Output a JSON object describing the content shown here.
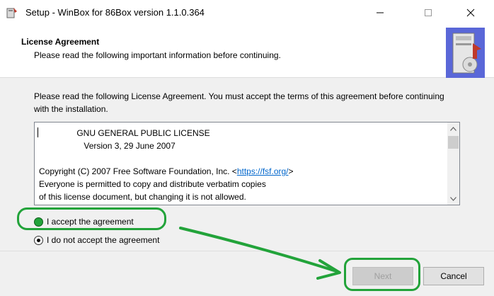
{
  "window": {
    "title": "Setup - WinBox for 86Box version 1.1.0.364",
    "controls": [
      "minimize",
      "maximize",
      "close"
    ]
  },
  "header": {
    "title": "License Agreement",
    "subtitle": "Please read the following important information before continuing."
  },
  "main": {
    "intro": "Please read the following License Agreement. You must accept the terms of this agreement before continuing with the installation.",
    "license_lines": [
      "                GNU GENERAL PUBLIC LICENSE",
      "                   Version 3, 29 June 2007",
      "",
      "Copyright (C) 2007 Free Software Foundation, Inc. <",
      "Everyone is permitted to copy and distribute verbatim copies",
      "of this license document, but changing it is not allowed."
    ],
    "license_link": "https://fsf.org/",
    "license_link_suffix": ">",
    "radio_accept_label": "I accept the agreement",
    "radio_decline_label": "I do not accept the agreement",
    "accept_selected": true
  },
  "footer": {
    "next_label": "Next",
    "cancel_label": "Cancel"
  },
  "colors": {
    "highlight": "#22a33a",
    "link": "#0066cc"
  },
  "icons": {
    "app": "setup-installer-icon",
    "wizard": "computer-install-icon"
  }
}
